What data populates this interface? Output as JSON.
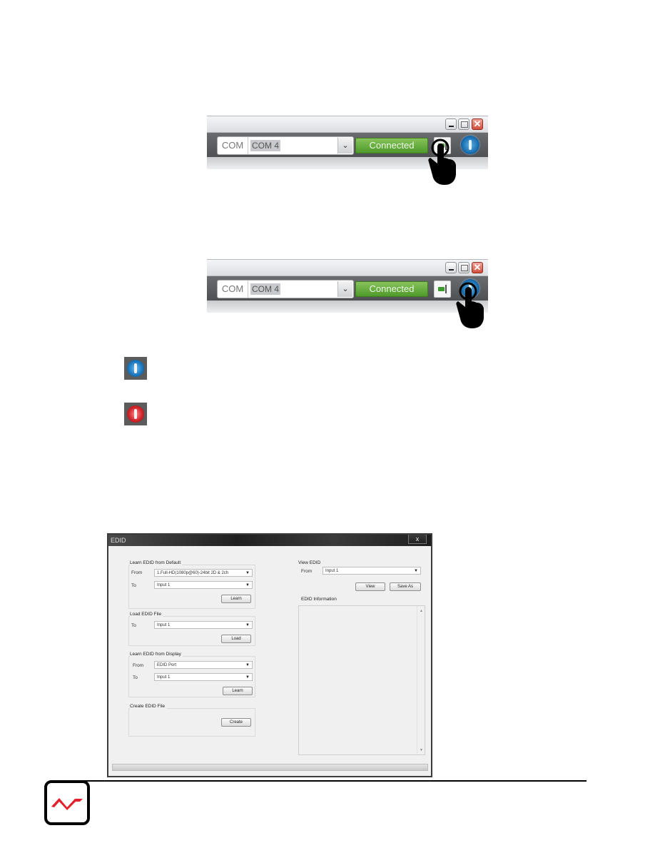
{
  "toolbar_top": {
    "com_label": "COM",
    "com_value": "COM 4",
    "status_label": "Connected",
    "window_buttons": [
      "minimize",
      "maximize",
      "close"
    ],
    "pointer_target": "connection-plug-button"
  },
  "toolbar_bottom": {
    "com_label": "COM",
    "com_value": "COM 4",
    "status_label": "Connected",
    "window_buttons": [
      "minimize",
      "maximize",
      "close"
    ],
    "pointer_target": "power-button"
  },
  "legend_icons": [
    {
      "name": "power-icon-blue",
      "color": "#1d79bf"
    },
    {
      "name": "power-icon-red",
      "color": "#d0252b"
    }
  ],
  "edid_dialog": {
    "title": "EDID",
    "close_label": "x",
    "learn_default": {
      "title": "Learn EDID from Default",
      "from_label": "From",
      "from_value": "1.Full-HD(1080p@60)-24bit 2D & 2ch",
      "to_label": "To",
      "to_value": "Input 1",
      "button": "Learn"
    },
    "load_file": {
      "title": "Load EDID File",
      "to_label": "To",
      "to_value": "Input 1",
      "button": "Load"
    },
    "learn_display": {
      "title": "Learn EDID from Display",
      "from_label": "From",
      "from_value": "EDID Port",
      "to_label": "To",
      "to_value": "Input 1",
      "button": "Learn"
    },
    "create_file": {
      "title": "Create EDID File",
      "button": "Create"
    },
    "view": {
      "title": "View EDID",
      "from_label": "From",
      "from_value": "Input 1",
      "view_button": "View",
      "save_button": "Save As",
      "info_label": "EDID Information",
      "info_text": ""
    }
  },
  "footer": {
    "logo": "brand-logo",
    "logo_color": "#e3202b"
  }
}
